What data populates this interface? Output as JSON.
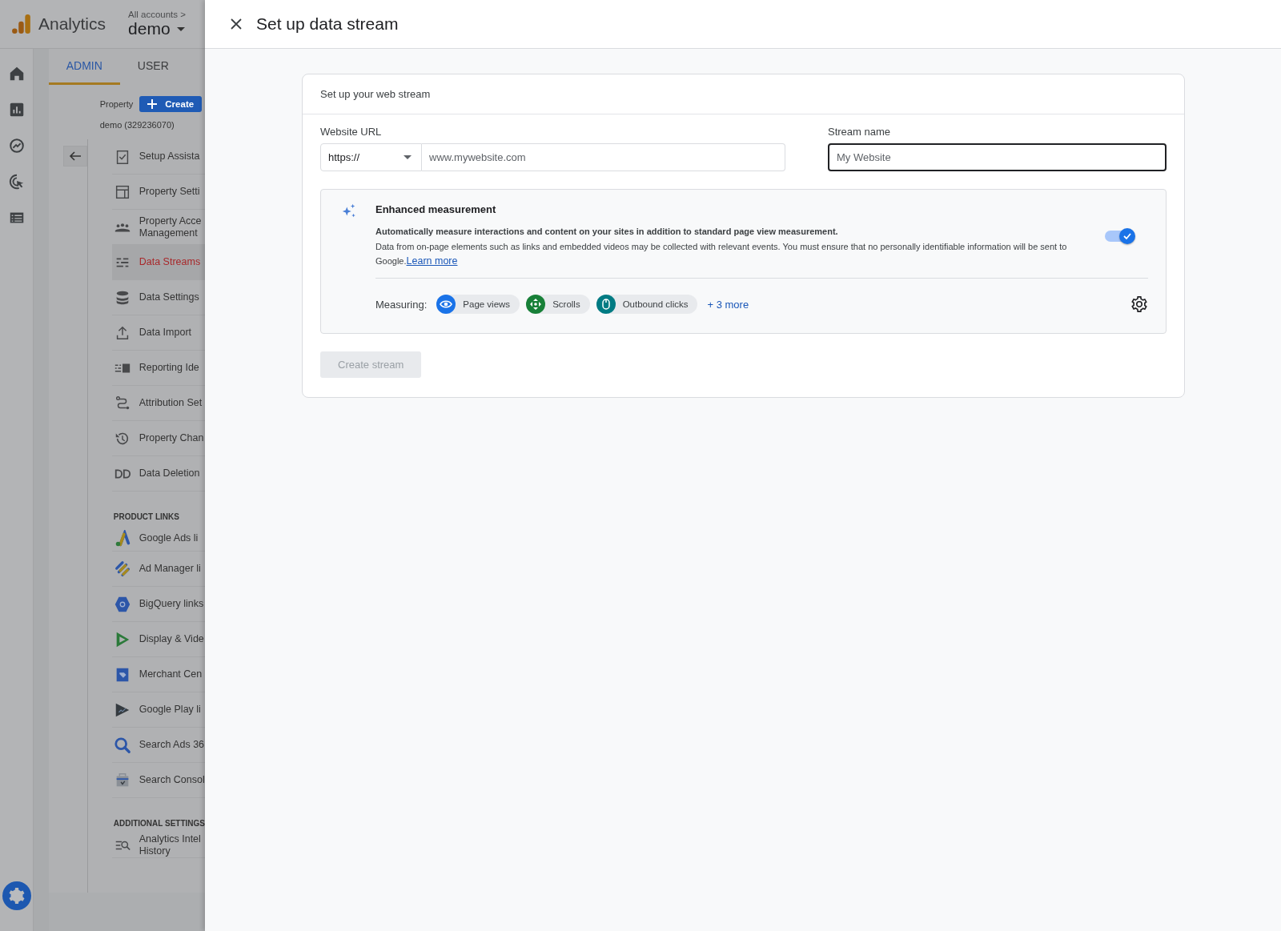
{
  "app": {
    "product": "Analytics",
    "breadcrumb": "All accounts >",
    "account": "demo"
  },
  "admin_tabs": [
    {
      "label": "ADMIN",
      "selected": true
    },
    {
      "label": "USER",
      "selected": false
    }
  ],
  "property": {
    "label": "Property",
    "create_button": "Create",
    "name": "demo (329236070)"
  },
  "nav_sections": [
    {
      "items": [
        {
          "label": "Setup Assista",
          "selected": false
        },
        {
          "label": "Property Setti",
          "selected": false
        },
        {
          "label": "Property Acce\nManagement",
          "selected": false
        },
        {
          "label": "Data Streams",
          "selected": true
        },
        {
          "label": "Data Settings",
          "selected": false
        },
        {
          "label": "Data Import",
          "selected": false
        },
        {
          "label": "Reporting Ide",
          "selected": false
        },
        {
          "label": "Attribution Set",
          "selected": false
        },
        {
          "label": "Property Chan",
          "selected": false
        },
        {
          "label": "Data Deletion",
          "selected": false
        }
      ]
    },
    {
      "heading": "PRODUCT LINKS",
      "items": [
        {
          "label": "Google Ads li",
          "selected": false
        },
        {
          "label": "Ad Manager li",
          "selected": false
        },
        {
          "label": "BigQuery links",
          "selected": false
        },
        {
          "label": "Display & Vide",
          "selected": false
        },
        {
          "label": "Merchant Cen",
          "selected": false
        },
        {
          "label": "Google Play li",
          "selected": false
        },
        {
          "label": "Search Ads 36",
          "selected": false
        },
        {
          "label": "Search Consol",
          "selected": false
        }
      ]
    },
    {
      "heading": "ADDITIONAL SETTINGS",
      "items": [
        {
          "label": "Analytics Intel\nHistory",
          "selected": false
        }
      ]
    }
  ],
  "drawer": {
    "title": "Set up data stream",
    "card": {
      "heading": "Set up your web stream",
      "website_url": {
        "label": "Website URL",
        "protocol": "https://",
        "placeholder": "www.mywebsite.com"
      },
      "stream_name": {
        "label": "Stream name",
        "placeholder": "My Website",
        "focused": true
      },
      "enhanced": {
        "title": "Enhanced measurement",
        "lead": "Automatically measure interactions and content on your sites in addition to standard page view measurement.",
        "description": "Data from on-page elements such as links and embedded videos may be collected with relevant events. You must ensure that no personally identifiable information will be sent to Google.",
        "link": "Learn more",
        "on": true,
        "measuring_label": "Measuring:",
        "chips": [
          {
            "label": "Page views",
            "color": "#1a73e8"
          },
          {
            "label": "Scrolls",
            "color": "#188038"
          },
          {
            "label": "Outbound clicks",
            "color": "#007b83"
          }
        ],
        "more": "+ 3 more"
      },
      "create_button": {
        "label": "Create stream",
        "disabled": true
      }
    }
  }
}
